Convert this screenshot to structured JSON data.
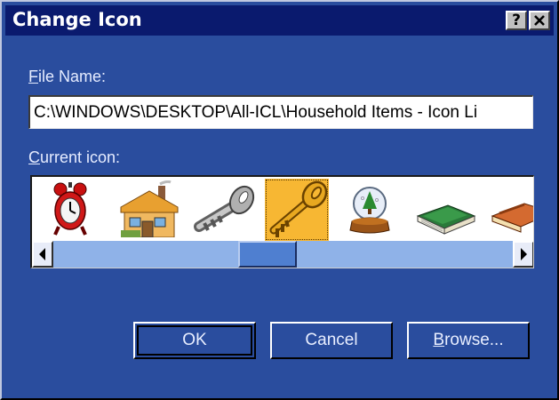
{
  "window": {
    "title": "Change Icon",
    "help_button": "?",
    "close_button": "✕"
  },
  "file_name": {
    "label_underlined": "F",
    "label_rest": "ile Name:",
    "value": "C:\\WINDOWS\\DESKTOP\\All-ICL\\Household Items - Icon Li"
  },
  "current_icon": {
    "label_underlined": "C",
    "label_rest": "urrent icon:",
    "icons": [
      "alarm-clock-icon",
      "house-icon",
      "silver-key-icon",
      "gold-key-icon",
      "snow-globe-icon",
      "book-icon",
      "matchbox-icon"
    ],
    "selected_index": 3
  },
  "buttons": {
    "ok": "OK",
    "cancel": "Cancel",
    "browse_underlined": "B",
    "browse_rest": "rowse..."
  },
  "colors": {
    "dialog_bg": "#2a4d9e",
    "title_bg": "#0a1a6e",
    "selection": "#f7b733",
    "scroll_track": "#8fb2e8"
  }
}
